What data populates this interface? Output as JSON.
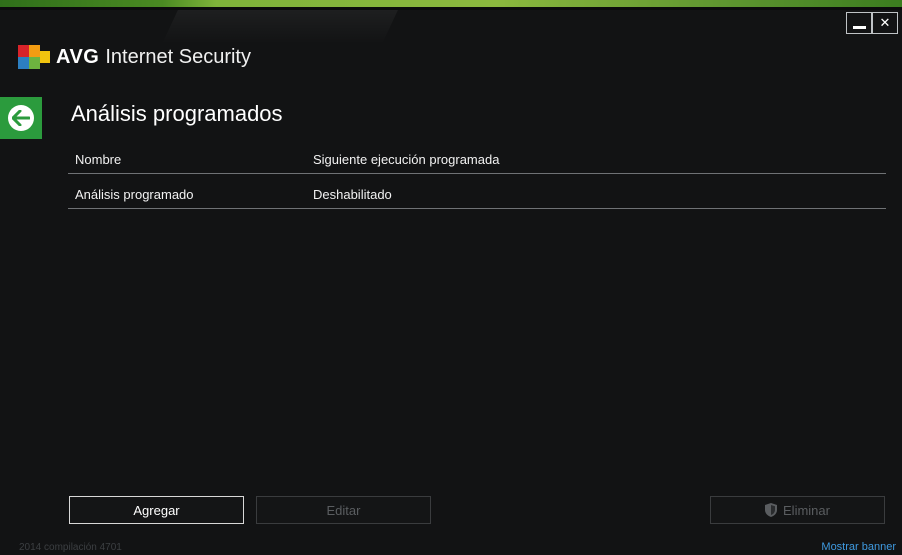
{
  "app": {
    "brand": "AVG",
    "product": "Internet Security"
  },
  "page": {
    "title": "Análisis programados"
  },
  "table": {
    "headers": [
      "Nombre",
      "Siguiente ejecución programada"
    ],
    "rows": [
      [
        "Análisis programado",
        "Deshabilitado"
      ]
    ]
  },
  "buttons": {
    "add": "Agregar",
    "edit": "Editar",
    "delete": "Eliminar"
  },
  "footer": {
    "version": "2014  compilación 4701",
    "show_banner": "Mostrar banner"
  },
  "icons": {
    "back": "back-arrow-icon",
    "delete": "shield-icon",
    "minimize": "minimize-icon",
    "close": "close-icon"
  },
  "colors": {
    "background": "#121314",
    "accent_green": "#2b9b3d",
    "link_blue": "#3f9ae0"
  }
}
